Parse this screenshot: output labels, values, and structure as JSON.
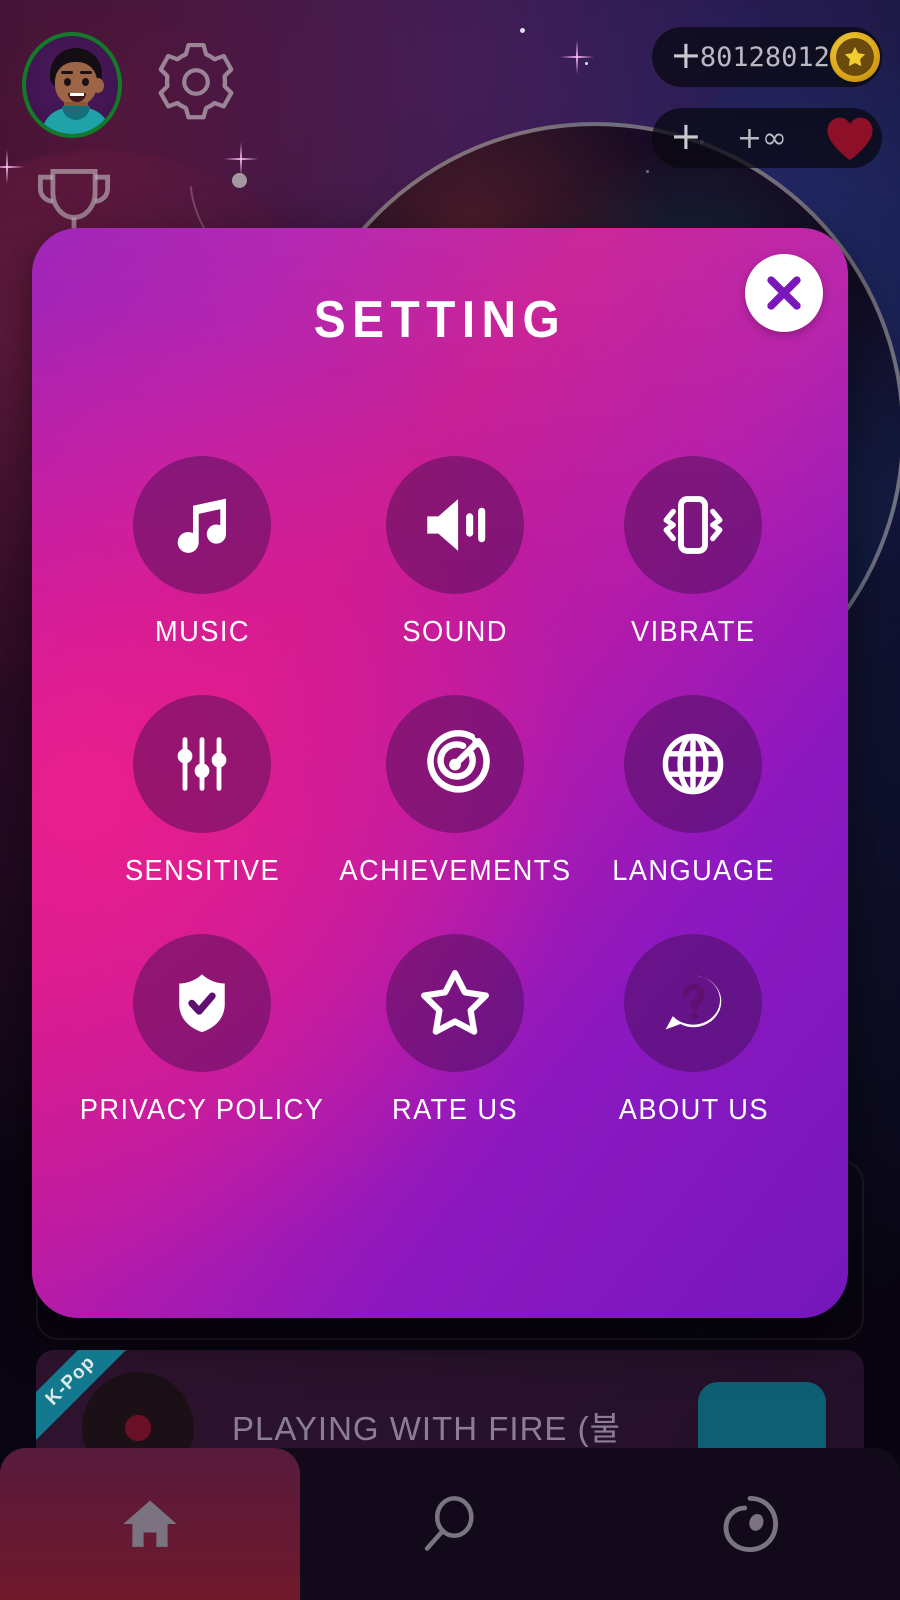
{
  "hud": {
    "avatar_name": "player-avatar",
    "gear_icon": "gear-icon",
    "trophy_icon": "trophy-icon",
    "coins": {
      "plus": "+",
      "value": "80128012",
      "icon": "star-coin-icon"
    },
    "lives": {
      "plus": "+",
      "value": "+∞",
      "icon": "heart-icon"
    }
  },
  "modal": {
    "title": "SETTING",
    "close_icon": "close-icon",
    "tiles": [
      {
        "label": "MUSIC",
        "icon": "music-note-icon"
      },
      {
        "label": "SOUND",
        "icon": "speaker-volume-icon"
      },
      {
        "label": "VIBRATE",
        "icon": "vibrate-phone-icon"
      },
      {
        "label": "SENSITIVE",
        "icon": "sliders-icon"
      },
      {
        "label": "ACHIEVEMENTS",
        "icon": "target-arrow-icon"
      },
      {
        "label": "LANGUAGE",
        "icon": "globe-icon"
      },
      {
        "label": "PRIVACY POLICY",
        "icon": "shield-check-icon"
      },
      {
        "label": "RATE US",
        "icon": "star-outline-icon"
      },
      {
        "label": "ABOUT US",
        "icon": "question-bubble-icon"
      }
    ]
  },
  "song_card": {
    "ribbon": "K-Pop",
    "title": "PLAYING WITH FIRE (불",
    "disc_icon": "vinyl-disc-icon",
    "play_icon": "play-button-icon"
  },
  "bottom_nav": [
    {
      "icon": "home-icon",
      "active": true
    },
    {
      "icon": "search-icon",
      "active": false
    },
    {
      "icon": "library-icon",
      "active": false
    }
  ],
  "colors": {
    "modal_pink": "#c71a93",
    "modal_purple": "#7417bb",
    "accent_white": "#ffffff",
    "coin_gold": "#f5d43a",
    "heart_red": "#8e1028",
    "avatar_ring": "#127a29"
  }
}
